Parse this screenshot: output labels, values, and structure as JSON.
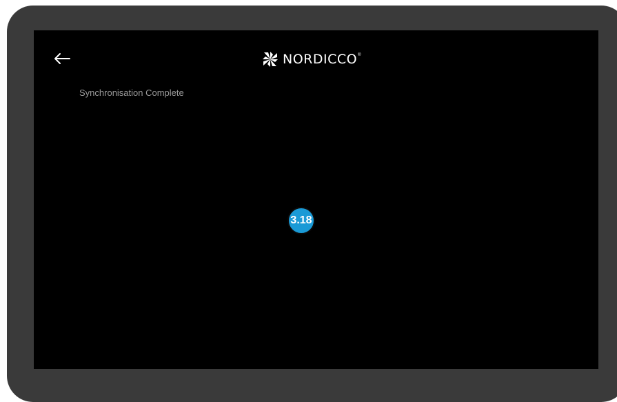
{
  "header": {
    "back_icon": "arrow-left-icon",
    "logo_text": "NORDICCO",
    "logo_mark_icon": "nordicco-logo-icon",
    "logo_registered": "®"
  },
  "main": {
    "status_text": "Synchronisation Complete",
    "badge_label": "3.18"
  },
  "colors": {
    "bezel": "#3a3a3a",
    "screen": "#000000",
    "badge": "#1a9ad6",
    "status_text": "#9a9a9a"
  }
}
